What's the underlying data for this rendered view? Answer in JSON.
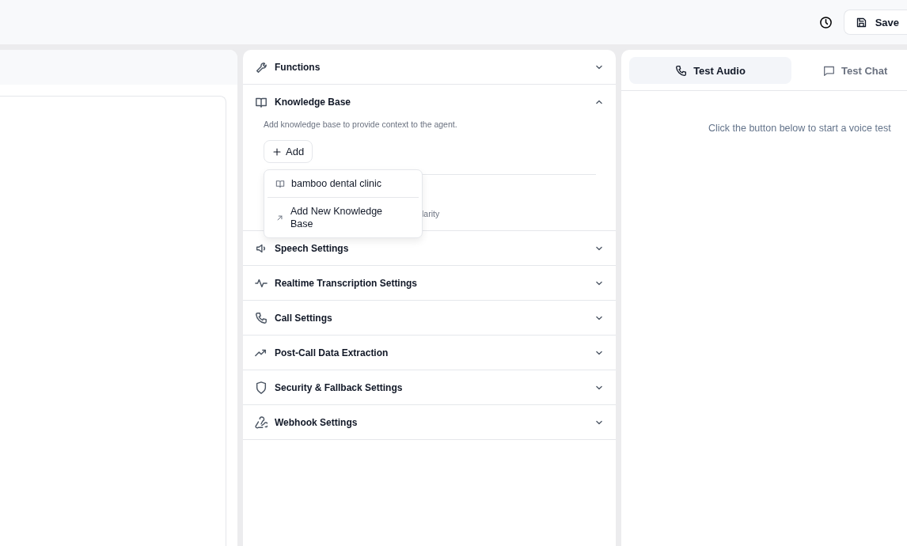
{
  "toolbar": {
    "save_label": "Save"
  },
  "sections": [
    {
      "label": "Functions",
      "expanded": false
    },
    {
      "label": "Knowledge Base",
      "expanded": true,
      "description": "Add knowledge base to provide context to the agent.",
      "add_label": "Add",
      "partial_note": "larity"
    },
    {
      "label": "Speech Settings",
      "expanded": false
    },
    {
      "label": "Realtime Transcription Settings",
      "expanded": false
    },
    {
      "label": "Call Settings",
      "expanded": false
    },
    {
      "label": "Post-Call Data Extraction",
      "expanded": false
    },
    {
      "label": "Security & Fallback Settings",
      "expanded": false
    },
    {
      "label": "Webhook Settings",
      "expanded": false
    }
  ],
  "dropdown": {
    "items": [
      {
        "kind": "knowledge",
        "label": "bamboo dental clinic"
      },
      {
        "kind": "link",
        "label": "Add New Knowledge Base"
      }
    ]
  },
  "test_panel": {
    "tabs": [
      {
        "label": "Test Audio",
        "selected": true
      },
      {
        "label": "Test Chat",
        "selected": false
      }
    ],
    "hint": "Click the button below to start a voice test"
  }
}
